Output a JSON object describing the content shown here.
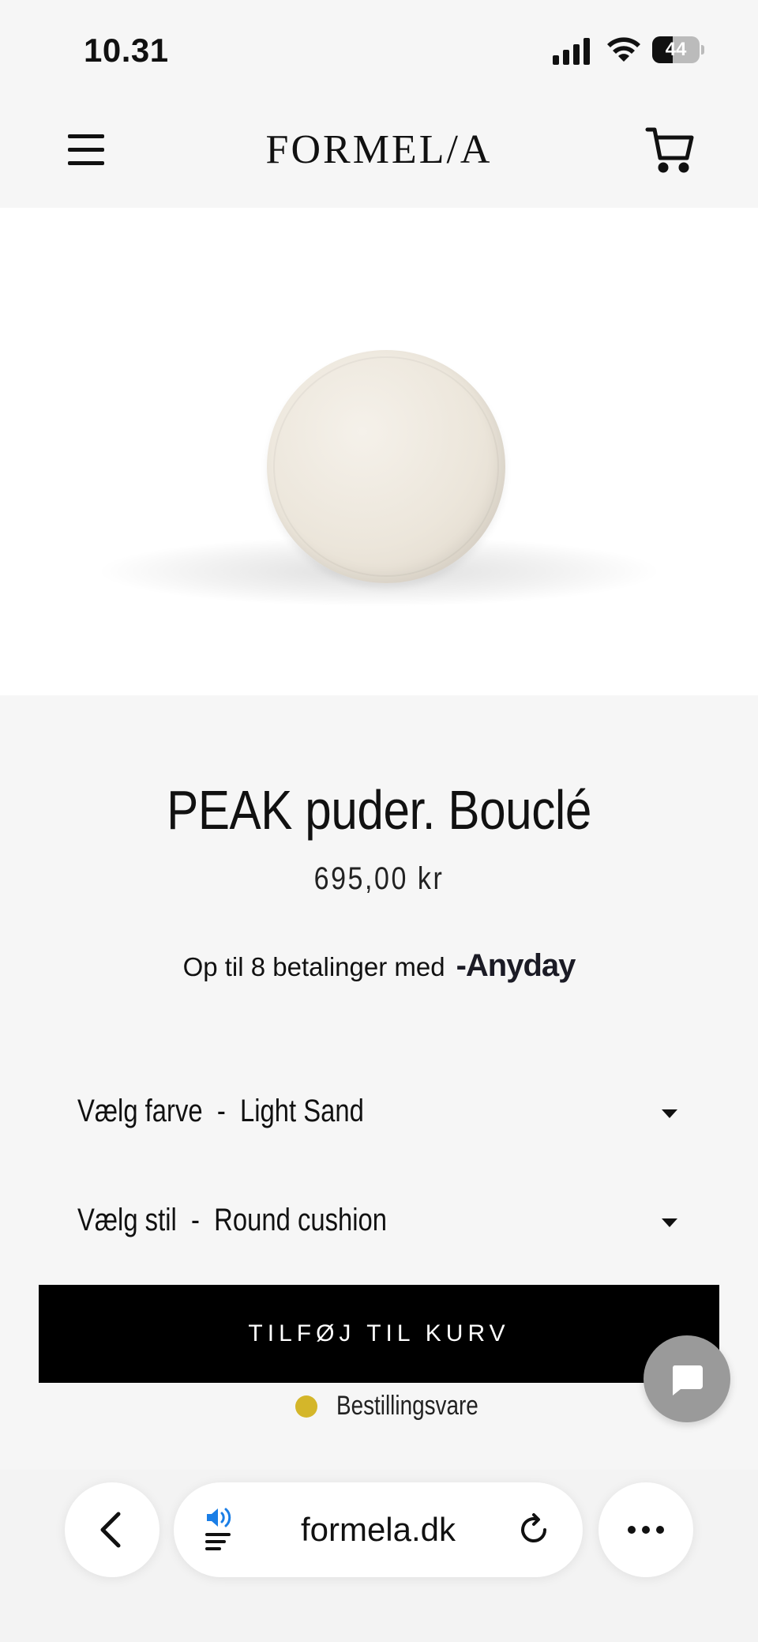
{
  "status_bar": {
    "time": "10.31",
    "battery": "44",
    "battery_fraction": 0.44
  },
  "header": {
    "logo": "FORMEL/A"
  },
  "product": {
    "title": "PEAK puder. Bouclé",
    "price": "695,00 kr",
    "installments_text": "Op til 8 betalinger med",
    "installments_brand": "Anyday"
  },
  "options": [
    {
      "label": "Vælg farve",
      "separator": "-",
      "value": "Light Sand"
    },
    {
      "label": "Vælg stil",
      "separator": "-",
      "value": "Round cushion"
    }
  ],
  "cart": {
    "add_label": "TILFØJ TIL KURV"
  },
  "stock": {
    "status": "Bestillingsvare",
    "color": "#d4b62a"
  },
  "browser": {
    "url": "formela.dk"
  },
  "icons": {
    "menu": "hamburger-menu-icon",
    "cart": "shopping-cart-icon",
    "chat": "chat-bubble-icon",
    "back": "chevron-left-icon",
    "reader": "listen-reader-icon",
    "reload": "reload-icon",
    "more": "ellipsis-icon"
  }
}
